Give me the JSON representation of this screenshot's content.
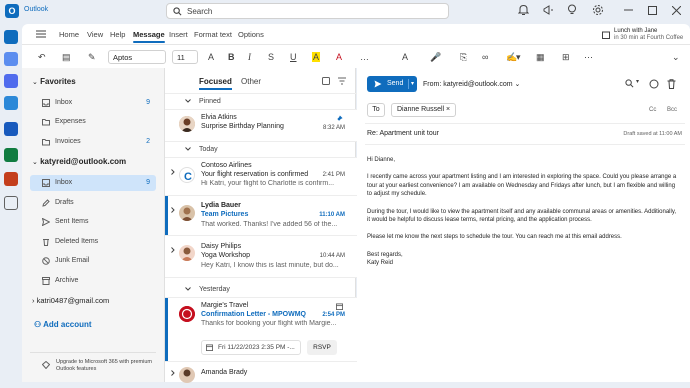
{
  "app": {
    "name": "Outlook"
  },
  "search": {
    "placeholder": "Search"
  },
  "reminder": {
    "title": "Lunch with Jane",
    "detail": "in 30 min at Fourth Coffee"
  },
  "ribbon_tabs": [
    "Home",
    "View",
    "Help",
    "Message",
    "Insert",
    "Format text",
    "Options"
  ],
  "ribbon": {
    "font": "Aptos",
    "size": "11"
  },
  "folders": {
    "favorites_label": "Favorites",
    "favorites": [
      {
        "label": "Inbox",
        "count": "9",
        "icon": "inbox-icon"
      },
      {
        "label": "Expenses",
        "count": "",
        "icon": "folder-icon"
      },
      {
        "label": "Invoices",
        "count": "2",
        "icon": "folder-icon"
      }
    ],
    "account": "katyreid@outlook.com",
    "account_items": [
      {
        "label": "Inbox",
        "count": "9",
        "icon": "inbox-icon"
      },
      {
        "label": "Drafts",
        "count": "",
        "icon": "pencil-icon"
      },
      {
        "label": "Sent Items",
        "count": "",
        "icon": "send-icon"
      },
      {
        "label": "Deleted Items",
        "count": "",
        "icon": "trash-icon"
      },
      {
        "label": "Junk Email",
        "count": "",
        "icon": "junk-icon"
      },
      {
        "label": "Archive",
        "count": "",
        "icon": "archive-icon"
      }
    ],
    "account2": "katri0487@gmail.com",
    "add_account": "Add account",
    "upgrade": "Upgrade to Microsoft 365 with premium Outlook features"
  },
  "list": {
    "tab_focused": "Focused",
    "tab_other": "Other",
    "group_pinned": "Pinned",
    "group_today": "Today",
    "group_yesterday": "Yesterday",
    "messages": [
      {
        "sender": "Elvia Atkins",
        "subject": "Surprise Birthday Planning",
        "preview": "",
        "time": "8:32 AM"
      },
      {
        "sender": "Contoso Airlines",
        "subject": "Your flight reservation is confirmed",
        "preview": "Hi Katri, your flight to Charlotte is confirm...",
        "time": "2:41 PM"
      },
      {
        "sender": "Lydia Bauer",
        "subject": "Team Pictures",
        "preview": "That worked. Thanks! I've added 56 of the...",
        "time": "11:10 AM"
      },
      {
        "sender": "Daisy Philips",
        "subject": "Yoga Workshop",
        "preview": "Hey Katri, I know this is last minute, but do...",
        "time": "10:44 AM"
      },
      {
        "sender": "Margie's Travel",
        "subject": "Confirmation Letter - MPOWMQ",
        "preview": "Thanks for booking your flight with Margie...",
        "time": "2:54 PM",
        "event": "Fri 11/22/2023 2:35 PM -...",
        "rsvp": "RSVP"
      },
      {
        "sender": "Amanda Brady",
        "subject": "",
        "preview": "",
        "time": ""
      }
    ]
  },
  "compose": {
    "send": "Send",
    "from": "From: katyreid@outlook.com",
    "to_label": "To",
    "recipient": "Dianne Russell",
    "cc": "Cc",
    "bcc": "Bcc",
    "subject": "Re: Apartment unit tour",
    "draft_saved": "Draft saved at 11:00 AM",
    "greeting": "Hi Dianne,",
    "p1": "I recently came across your apartment listing and I am interested in exploring the space. Could you please arrange a tour at your earliest convenience? I am available on Wednesday and Fridays after lunch, but I am flexible and willing to adjust my schedule.",
    "p2": "During the tour, I would like to view the apartment itself and any available communal areas or amenities. Additionally, it would be helpful to discuss lease terms, rental pricing, and the application process.",
    "p3": "Please let me know the next steps to schedule the tour. You can reach me at this email address.",
    "closing": "Best regards,",
    "signature": "Katy Reid"
  },
  "colors": {
    "accent": "#0f6cbd",
    "selected": "#cfe4fa"
  }
}
